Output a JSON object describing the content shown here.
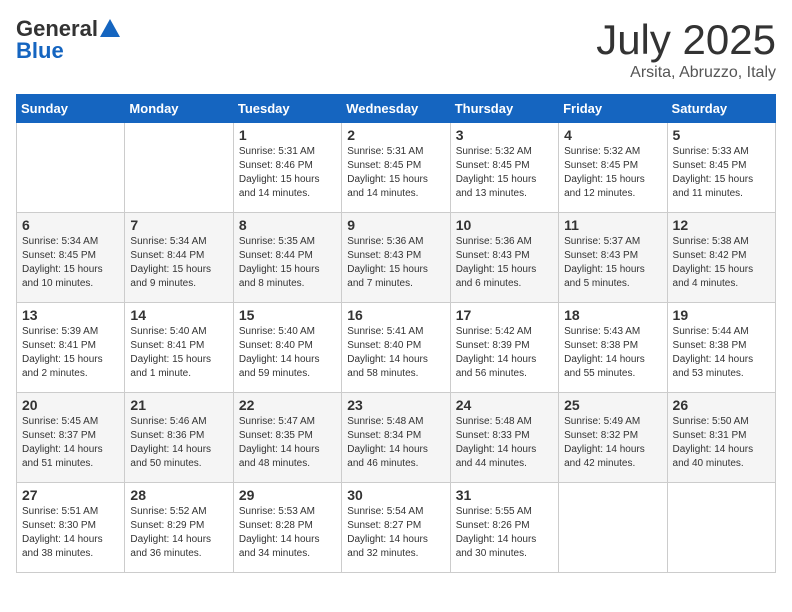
{
  "header": {
    "logo_general": "General",
    "logo_blue": "Blue",
    "title": "July 2025",
    "location": "Arsita, Abruzzo, Italy"
  },
  "weekdays": [
    "Sunday",
    "Monday",
    "Tuesday",
    "Wednesday",
    "Thursday",
    "Friday",
    "Saturday"
  ],
  "weeks": [
    [
      {
        "day": "",
        "sunrise": "",
        "sunset": "",
        "daylight": ""
      },
      {
        "day": "",
        "sunrise": "",
        "sunset": "",
        "daylight": ""
      },
      {
        "day": "1",
        "sunrise": "Sunrise: 5:31 AM",
        "sunset": "Sunset: 8:46 PM",
        "daylight": "Daylight: 15 hours and 14 minutes."
      },
      {
        "day": "2",
        "sunrise": "Sunrise: 5:31 AM",
        "sunset": "Sunset: 8:45 PM",
        "daylight": "Daylight: 15 hours and 14 minutes."
      },
      {
        "day": "3",
        "sunrise": "Sunrise: 5:32 AM",
        "sunset": "Sunset: 8:45 PM",
        "daylight": "Daylight: 15 hours and 13 minutes."
      },
      {
        "day": "4",
        "sunrise": "Sunrise: 5:32 AM",
        "sunset": "Sunset: 8:45 PM",
        "daylight": "Daylight: 15 hours and 12 minutes."
      },
      {
        "day": "5",
        "sunrise": "Sunrise: 5:33 AM",
        "sunset": "Sunset: 8:45 PM",
        "daylight": "Daylight: 15 hours and 11 minutes."
      }
    ],
    [
      {
        "day": "6",
        "sunrise": "Sunrise: 5:34 AM",
        "sunset": "Sunset: 8:45 PM",
        "daylight": "Daylight: 15 hours and 10 minutes."
      },
      {
        "day": "7",
        "sunrise": "Sunrise: 5:34 AM",
        "sunset": "Sunset: 8:44 PM",
        "daylight": "Daylight: 15 hours and 9 minutes."
      },
      {
        "day": "8",
        "sunrise": "Sunrise: 5:35 AM",
        "sunset": "Sunset: 8:44 PM",
        "daylight": "Daylight: 15 hours and 8 minutes."
      },
      {
        "day": "9",
        "sunrise": "Sunrise: 5:36 AM",
        "sunset": "Sunset: 8:43 PM",
        "daylight": "Daylight: 15 hours and 7 minutes."
      },
      {
        "day": "10",
        "sunrise": "Sunrise: 5:36 AM",
        "sunset": "Sunset: 8:43 PM",
        "daylight": "Daylight: 15 hours and 6 minutes."
      },
      {
        "day": "11",
        "sunrise": "Sunrise: 5:37 AM",
        "sunset": "Sunset: 8:43 PM",
        "daylight": "Daylight: 15 hours and 5 minutes."
      },
      {
        "day": "12",
        "sunrise": "Sunrise: 5:38 AM",
        "sunset": "Sunset: 8:42 PM",
        "daylight": "Daylight: 15 hours and 4 minutes."
      }
    ],
    [
      {
        "day": "13",
        "sunrise": "Sunrise: 5:39 AM",
        "sunset": "Sunset: 8:41 PM",
        "daylight": "Daylight: 15 hours and 2 minutes."
      },
      {
        "day": "14",
        "sunrise": "Sunrise: 5:40 AM",
        "sunset": "Sunset: 8:41 PM",
        "daylight": "Daylight: 15 hours and 1 minute."
      },
      {
        "day": "15",
        "sunrise": "Sunrise: 5:40 AM",
        "sunset": "Sunset: 8:40 PM",
        "daylight": "Daylight: 14 hours and 59 minutes."
      },
      {
        "day": "16",
        "sunrise": "Sunrise: 5:41 AM",
        "sunset": "Sunset: 8:40 PM",
        "daylight": "Daylight: 14 hours and 58 minutes."
      },
      {
        "day": "17",
        "sunrise": "Sunrise: 5:42 AM",
        "sunset": "Sunset: 8:39 PM",
        "daylight": "Daylight: 14 hours and 56 minutes."
      },
      {
        "day": "18",
        "sunrise": "Sunrise: 5:43 AM",
        "sunset": "Sunset: 8:38 PM",
        "daylight": "Daylight: 14 hours and 55 minutes."
      },
      {
        "day": "19",
        "sunrise": "Sunrise: 5:44 AM",
        "sunset": "Sunset: 8:38 PM",
        "daylight": "Daylight: 14 hours and 53 minutes."
      }
    ],
    [
      {
        "day": "20",
        "sunrise": "Sunrise: 5:45 AM",
        "sunset": "Sunset: 8:37 PM",
        "daylight": "Daylight: 14 hours and 51 minutes."
      },
      {
        "day": "21",
        "sunrise": "Sunrise: 5:46 AM",
        "sunset": "Sunset: 8:36 PM",
        "daylight": "Daylight: 14 hours and 50 minutes."
      },
      {
        "day": "22",
        "sunrise": "Sunrise: 5:47 AM",
        "sunset": "Sunset: 8:35 PM",
        "daylight": "Daylight: 14 hours and 48 minutes."
      },
      {
        "day": "23",
        "sunrise": "Sunrise: 5:48 AM",
        "sunset": "Sunset: 8:34 PM",
        "daylight": "Daylight: 14 hours and 46 minutes."
      },
      {
        "day": "24",
        "sunrise": "Sunrise: 5:48 AM",
        "sunset": "Sunset: 8:33 PM",
        "daylight": "Daylight: 14 hours and 44 minutes."
      },
      {
        "day": "25",
        "sunrise": "Sunrise: 5:49 AM",
        "sunset": "Sunset: 8:32 PM",
        "daylight": "Daylight: 14 hours and 42 minutes."
      },
      {
        "day": "26",
        "sunrise": "Sunrise: 5:50 AM",
        "sunset": "Sunset: 8:31 PM",
        "daylight": "Daylight: 14 hours and 40 minutes."
      }
    ],
    [
      {
        "day": "27",
        "sunrise": "Sunrise: 5:51 AM",
        "sunset": "Sunset: 8:30 PM",
        "daylight": "Daylight: 14 hours and 38 minutes."
      },
      {
        "day": "28",
        "sunrise": "Sunrise: 5:52 AM",
        "sunset": "Sunset: 8:29 PM",
        "daylight": "Daylight: 14 hours and 36 minutes."
      },
      {
        "day": "29",
        "sunrise": "Sunrise: 5:53 AM",
        "sunset": "Sunset: 8:28 PM",
        "daylight": "Daylight: 14 hours and 34 minutes."
      },
      {
        "day": "30",
        "sunrise": "Sunrise: 5:54 AM",
        "sunset": "Sunset: 8:27 PM",
        "daylight": "Daylight: 14 hours and 32 minutes."
      },
      {
        "day": "31",
        "sunrise": "Sunrise: 5:55 AM",
        "sunset": "Sunset: 8:26 PM",
        "daylight": "Daylight: 14 hours and 30 minutes."
      },
      {
        "day": "",
        "sunrise": "",
        "sunset": "",
        "daylight": ""
      },
      {
        "day": "",
        "sunrise": "",
        "sunset": "",
        "daylight": ""
      }
    ]
  ]
}
